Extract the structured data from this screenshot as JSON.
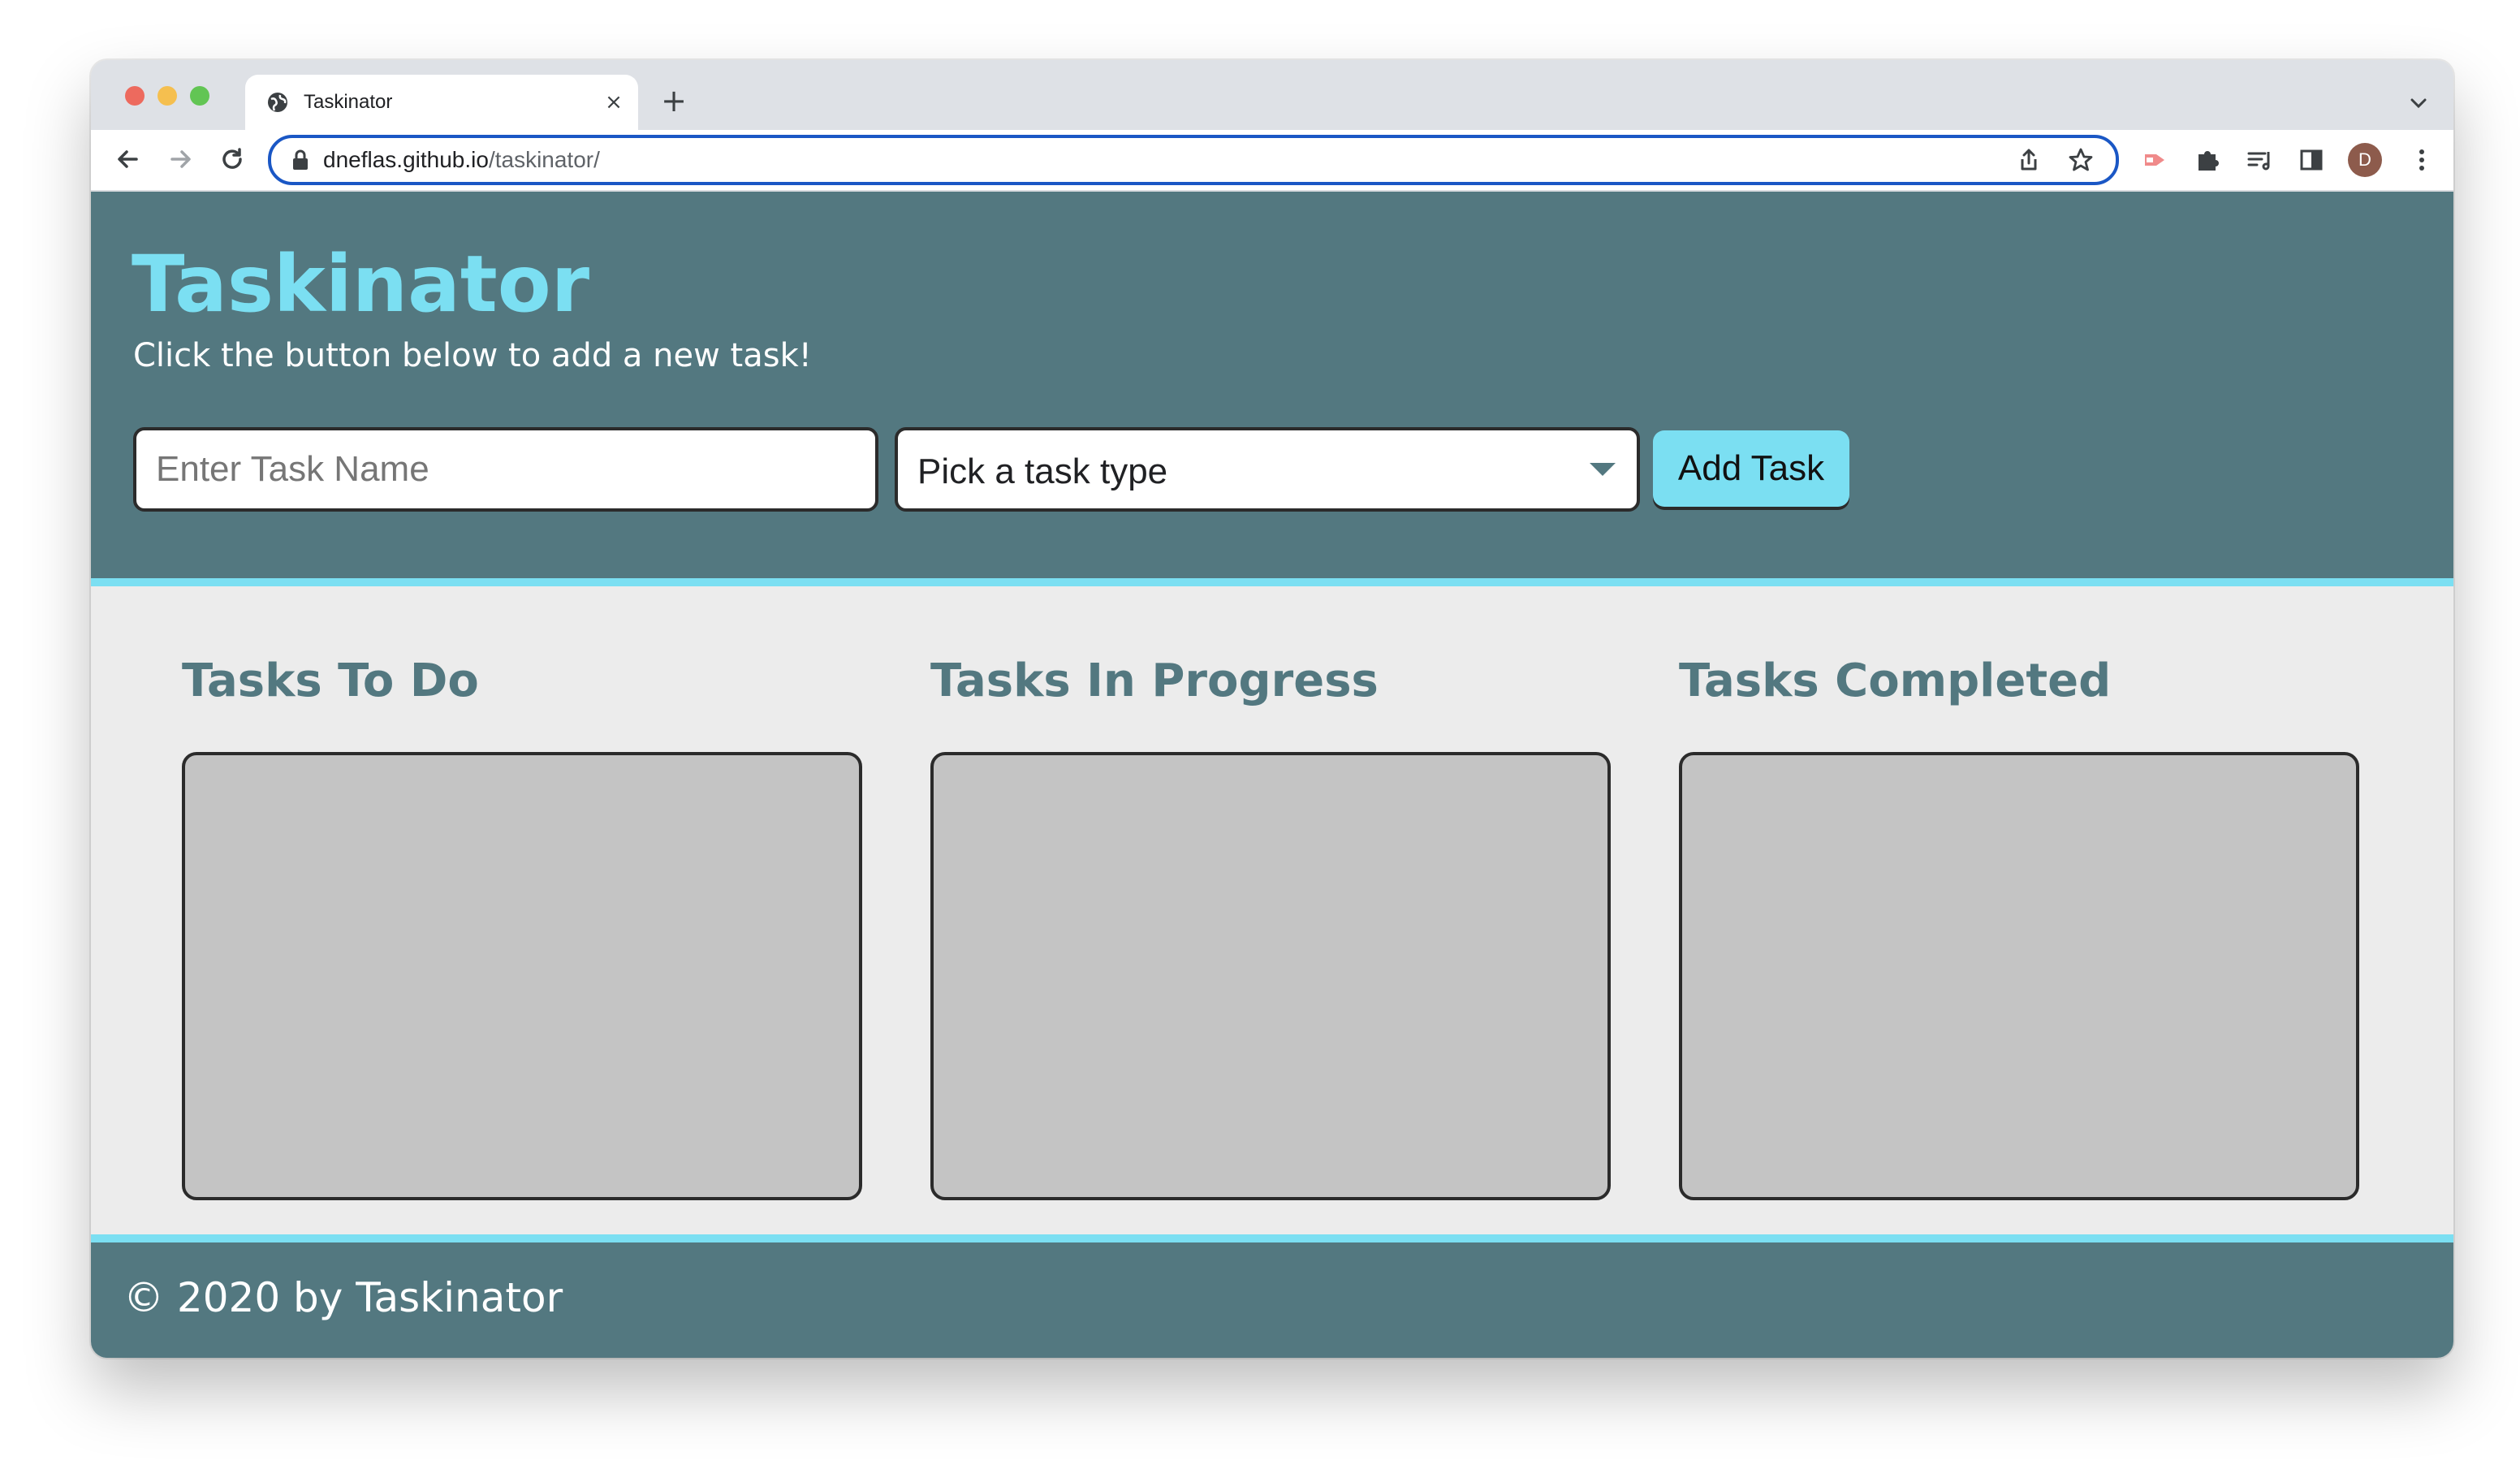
{
  "browser": {
    "tab_title": "Taskinator",
    "tab_close_glyph": "×",
    "new_tab_glyph": "+",
    "url_host": "dneflas.github.io",
    "url_path": "/taskinator/",
    "profile_initial": "D",
    "accent_color": "#1a57c5"
  },
  "header": {
    "title": "Taskinator",
    "subtitle": "Click the button below to add a new task!"
  },
  "form": {
    "task_name_placeholder": "Enter Task Name",
    "task_name_value": "",
    "task_type_selected": "Pick a task type",
    "submit_label": "Add Task"
  },
  "columns": [
    {
      "title": "Tasks To Do",
      "tasks": []
    },
    {
      "title": "Tasks In Progress",
      "tasks": []
    },
    {
      "title": "Tasks Completed",
      "tasks": []
    }
  ],
  "footer": {
    "text": "© 2020 by Taskinator"
  },
  "colors": {
    "primary": "#537880",
    "accent": "#7bdff2",
    "background": "#ececec",
    "list_background": "#c4c4c4"
  }
}
